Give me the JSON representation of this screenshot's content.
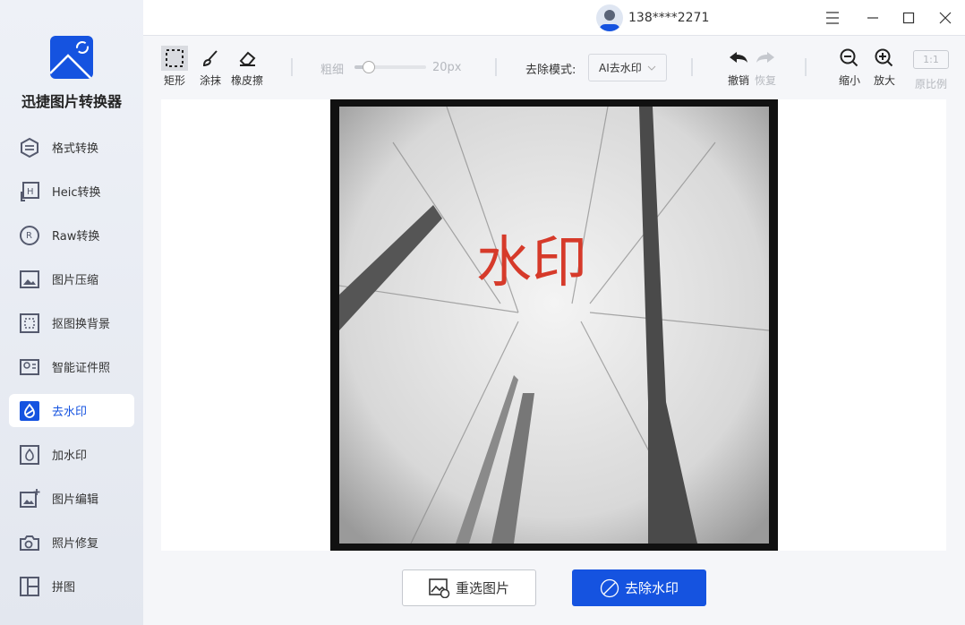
{
  "app": {
    "name": "迅捷图片转换器"
  },
  "user": {
    "phone": "138****2271"
  },
  "sidebar": {
    "items": [
      {
        "label": "格式转换",
        "icon": "format-convert-icon"
      },
      {
        "label": "Heic转换",
        "icon": "heic-icon"
      },
      {
        "label": "Raw转换",
        "icon": "raw-icon"
      },
      {
        "label": "图片压缩",
        "icon": "compress-icon"
      },
      {
        "label": "抠图换背景",
        "icon": "cutout-icon"
      },
      {
        "label": "智能证件照",
        "icon": "id-photo-icon"
      },
      {
        "label": "去水印",
        "icon": "remove-watermark-icon",
        "active": true
      },
      {
        "label": "加水印",
        "icon": "add-watermark-icon"
      },
      {
        "label": "图片编辑",
        "icon": "image-edit-icon"
      },
      {
        "label": "照片修复",
        "icon": "photo-repair-icon"
      },
      {
        "label": "拼图",
        "icon": "collage-icon"
      }
    ]
  },
  "toolbar": {
    "rect": "矩形",
    "smear": "涂抹",
    "eraser": "橡皮擦",
    "thickness_label": "粗细",
    "thickness_value": "20px",
    "thickness_fraction": 0.2,
    "mode_label": "去除模式:",
    "mode_value": "AI去水印",
    "undo": "撤销",
    "redo": "恢复",
    "zoom_out": "缩小",
    "zoom_in": "放大",
    "ratio_badge": "1:1",
    "ratio": "原比例"
  },
  "image": {
    "watermark_text": "水印"
  },
  "actions": {
    "reselect": "重选图片",
    "remove": "去除水印"
  },
  "colors": {
    "accent": "#1553e0",
    "watermark": "#d63a2a"
  }
}
